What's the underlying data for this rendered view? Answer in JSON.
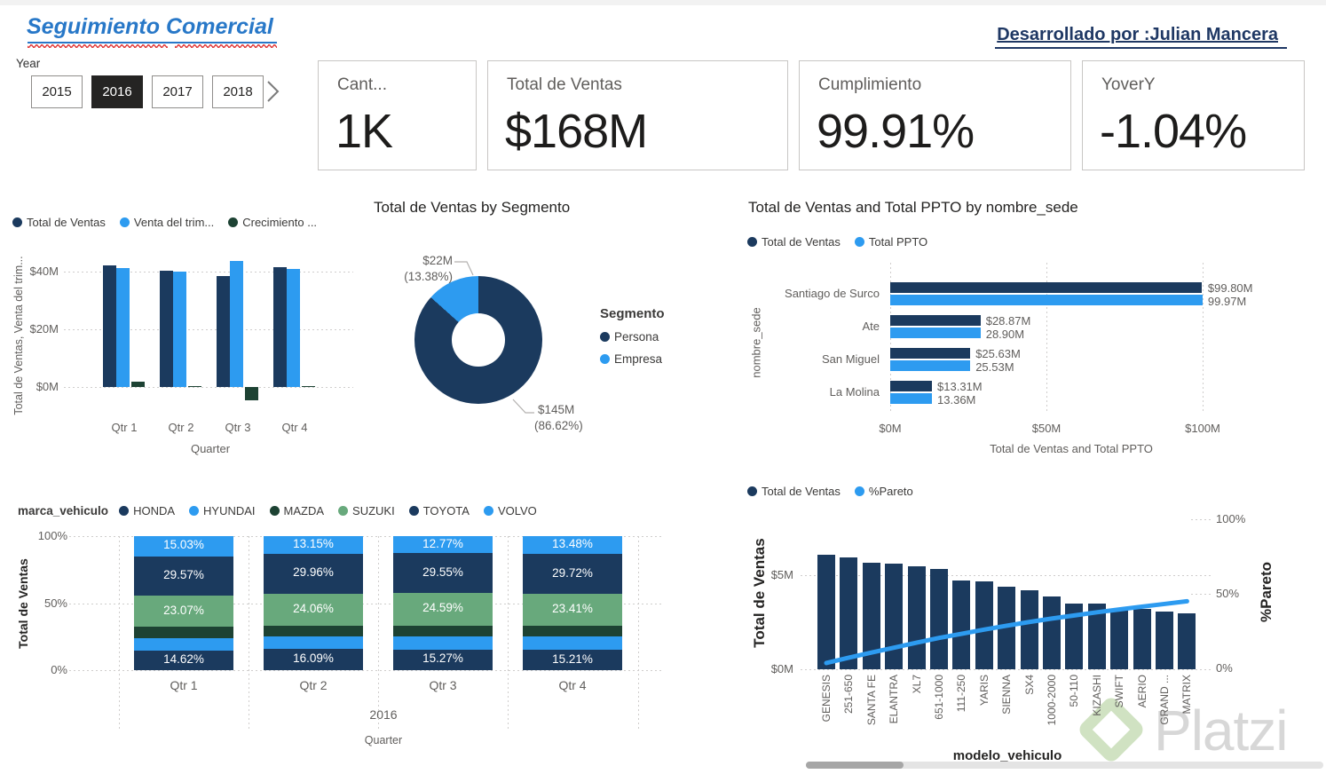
{
  "page": {
    "title": "Seguimiento Comercial",
    "credit": "Desarrollado por :Julian Mancera"
  },
  "slicer": {
    "label": "Year",
    "options": [
      "2015",
      "2016",
      "2017",
      "2018"
    ],
    "selected": "2016"
  },
  "kpis": [
    {
      "label": "Cant...",
      "value": "1K"
    },
    {
      "label": "Total de Ventas",
      "value": "$168M"
    },
    {
      "label": "Cumplimiento",
      "value": "99.91%"
    },
    {
      "label": "YoverY",
      "value": "-1.04%"
    }
  ],
  "colors": {
    "navy": "#1b3a5e",
    "blue": "#2d9bf0",
    "green_dark": "#1d4233",
    "sage": "#68a97c"
  },
  "watermark": {
    "text": "Platzi"
  },
  "chart_data": [
    {
      "id": "ventas-venta-trimestre-crecimiento-por-quarter",
      "type": "bar",
      "title": "",
      "xlabel": "Quarter",
      "ylabel": "Total de Ventas, Venta del trim...",
      "categories": [
        "Qtr 1",
        "Qtr 2",
        "Qtr 3",
        "Qtr 4"
      ],
      "yticks": [
        {
          "label": "$0M",
          "v": 0
        },
        {
          "label": "$20M",
          "v": 20
        },
        {
          "label": "$40M",
          "v": 40
        }
      ],
      "series": [
        {
          "name": "Total de Ventas",
          "color": "navy",
          "values": [
            42.1,
            40.2,
            38.4,
            41.5
          ]
        },
        {
          "name": "Venta del trim...",
          "color": "blue",
          "values": [
            41.0,
            39.9,
            43.6,
            40.8
          ]
        },
        {
          "name": "Crecimiento ...",
          "color": "green_dark",
          "values": [
            1.9,
            0.4,
            -4.7,
            0.4
          ]
        }
      ]
    },
    {
      "id": "ventas-por-segmento",
      "type": "pie",
      "title": "Total de Ventas by Segmento",
      "legend_title": "Segmento",
      "slices": [
        {
          "name": "Persona",
          "color": "navy",
          "value_m": 145,
          "pct": 86.62,
          "label_value": "$145M",
          "label_pct": "(86.62%)"
        },
        {
          "name": "Empresa",
          "color": "blue",
          "value_m": 22,
          "pct": 13.38,
          "label_value": "$22M",
          "label_pct": "(13.38%)"
        }
      ]
    },
    {
      "id": "ventas-ppto-por-sede",
      "type": "bar",
      "orientation": "horizontal",
      "title": "Total de Ventas and Total PPTO by nombre_sede",
      "xlabel": "Total de Ventas and Total PPTO",
      "ylabel": "nombre_sede",
      "categories": [
        "Santiago de Surco",
        "Ate",
        "San Miguel",
        "La Molina"
      ],
      "xticks": [
        {
          "label": "$0M",
          "v": 0
        },
        {
          "label": "$50M",
          "v": 50
        },
        {
          "label": "$100M",
          "v": 100
        }
      ],
      "series": [
        {
          "name": "Total de Ventas",
          "color": "navy",
          "values": [
            99.8,
            28.87,
            25.63,
            13.31
          ],
          "labels": [
            "$99.80M",
            "$28.87M",
            "$25.63M",
            "$13.31M"
          ]
        },
        {
          "name": "Total PPTO",
          "color": "blue",
          "values": [
            99.97,
            28.9,
            25.53,
            13.36
          ],
          "labels": [
            "99.97M",
            "28.90M",
            "25.53M",
            "13.36M"
          ]
        }
      ]
    },
    {
      "id": "mix-marca-vehiculo-por-quarter",
      "type": "bar",
      "stacked_pct": true,
      "legend_title": "marca_vehiculo",
      "xlabel": "Quarter",
      "ylabel": "Total de Ventas",
      "year_label": "2016",
      "categories": [
        "Qtr 1",
        "Qtr 2",
        "Qtr 3",
        "Qtr 4"
      ],
      "yticks": [
        {
          "label": "0%",
          "v": 0
        },
        {
          "label": "50%",
          "v": 50
        },
        {
          "label": "100%",
          "v": 100
        }
      ],
      "series": [
        {
          "name": "HONDA",
          "color": "navy",
          "labeled": true,
          "values": [
            14.62,
            16.09,
            15.27,
            15.21
          ]
        },
        {
          "name": "HYUNDAI",
          "color": "blue",
          "labeled": false,
          "values": [
            9.4,
            9.3,
            10.2,
            10.0
          ]
        },
        {
          "name": "MAZDA",
          "color": "green_dark",
          "labeled": false,
          "values": [
            8.31,
            7.44,
            7.62,
            8.18
          ]
        },
        {
          "name": "SUZUKI",
          "color": "sage",
          "labeled": true,
          "values": [
            23.07,
            24.06,
            24.59,
            23.41
          ]
        },
        {
          "name": "TOYOTA",
          "color": "navy",
          "labeled": true,
          "values": [
            29.57,
            29.96,
            29.55,
            29.72
          ]
        },
        {
          "name": "VOLVO",
          "color": "blue",
          "labeled": true,
          "values": [
            15.03,
            13.15,
            12.77,
            13.48
          ]
        }
      ]
    },
    {
      "id": "pareto-modelo-vehiculo",
      "type": "bar",
      "line_series": "%Pareto",
      "xlabel": "modelo_vehiculo",
      "ylabel": "Total de Ventas",
      "y2label": "%Pareto",
      "series": [
        {
          "name": "Total de Ventas",
          "color": "navy"
        },
        {
          "name": "%Pareto",
          "color": "blue"
        }
      ],
      "categories": [
        "GENESIS",
        "251-650",
        "SANTA FE",
        "ELANTRA",
        "XL7",
        "651-1000",
        "111-250",
        "YARIS",
        "SIENNA",
        "SX4",
        "1000-2000",
        "50-110",
        "KIZASHI",
        "SWIFT",
        "AERIO",
        "GRAND ...",
        "MATRIX"
      ],
      "values": [
        6.09,
        5.95,
        5.68,
        5.63,
        5.49,
        5.36,
        4.73,
        4.7,
        4.42,
        4.23,
        3.86,
        3.52,
        3.52,
        3.16,
        3.2,
        3.07,
        2.97
      ],
      "pareto_pct": [
        3.6,
        7.2,
        10.6,
        13.9,
        17.2,
        20.4,
        23.2,
        26.0,
        28.6,
        31.1,
        33.4,
        35.5,
        37.6,
        39.5,
        41.4,
        43.2,
        45.0
      ],
      "yticks": [
        {
          "label": "$0M",
          "v": 0
        },
        {
          "label": "$5M",
          "v": 5
        }
      ],
      "y2ticks": [
        {
          "label": "0%",
          "v": 0
        },
        {
          "label": "50%",
          "v": 50
        },
        {
          "label": "100%",
          "v": 100
        }
      ]
    }
  ]
}
